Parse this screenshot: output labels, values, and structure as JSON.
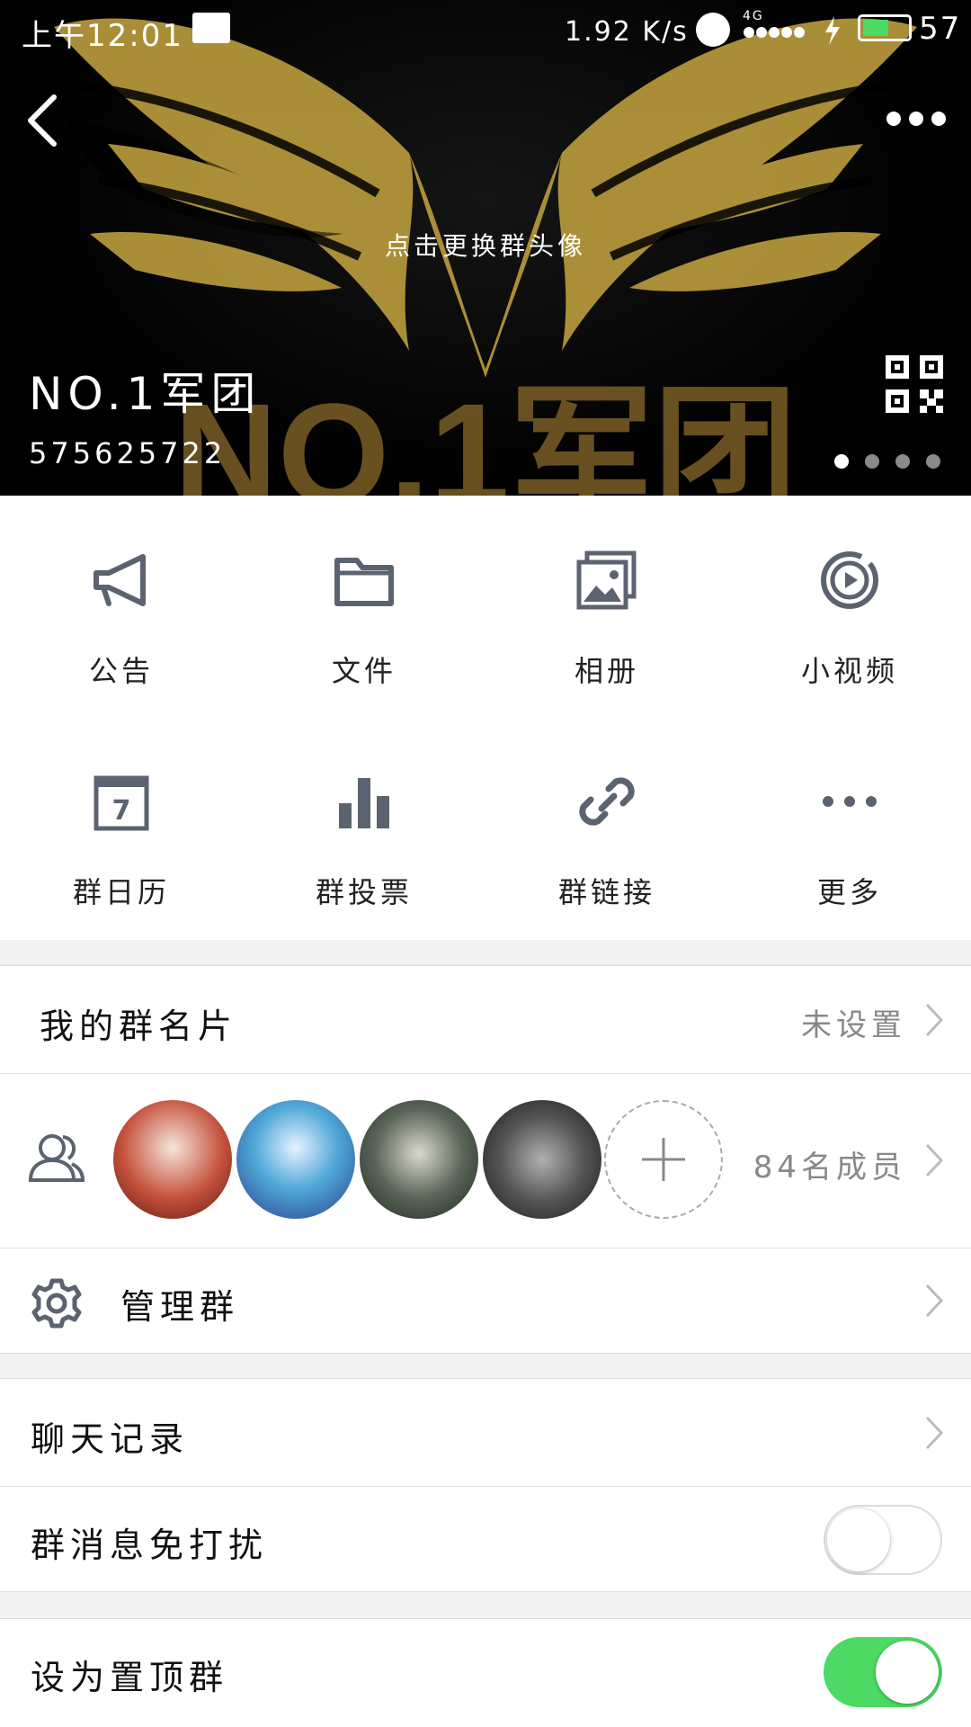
{
  "status_bar": {
    "time": "上午12:01",
    "speed": "1.92 K/s",
    "network": "4G",
    "battery": "57"
  },
  "header": {
    "change_avatar_hint": "点击更换群头像",
    "group_name": "NO.1军团",
    "group_id": "575625722",
    "banner_text": "NO.1军团",
    "page_count": 4,
    "active_page": 1
  },
  "features": [
    {
      "label": "公告",
      "icon": "megaphone-icon"
    },
    {
      "label": "文件",
      "icon": "folder-icon"
    },
    {
      "label": "相册",
      "icon": "photo-album-icon"
    },
    {
      "label": "小视频",
      "icon": "video-icon"
    },
    {
      "label": "群日历",
      "icon": "calendar-icon",
      "calendar_day": "7"
    },
    {
      "label": "群投票",
      "icon": "bar-chart-icon"
    },
    {
      "label": "群链接",
      "icon": "link-icon"
    },
    {
      "label": "更多",
      "icon": "more-dots-icon"
    }
  ],
  "my_card": {
    "label": "我的群名片",
    "value": "未设置"
  },
  "members": {
    "count_text": "84名成员"
  },
  "manage": {
    "label": "管理群"
  },
  "chat_history": {
    "label": "聊天记录"
  },
  "mute": {
    "label": "群消息免打扰",
    "on": false
  },
  "pin_top": {
    "label": "设为置顶群",
    "on": true
  },
  "colors": {
    "toggle_on": "#4cd964",
    "icon_gray": "#5c6370",
    "chevron": "#bbbbbb"
  }
}
